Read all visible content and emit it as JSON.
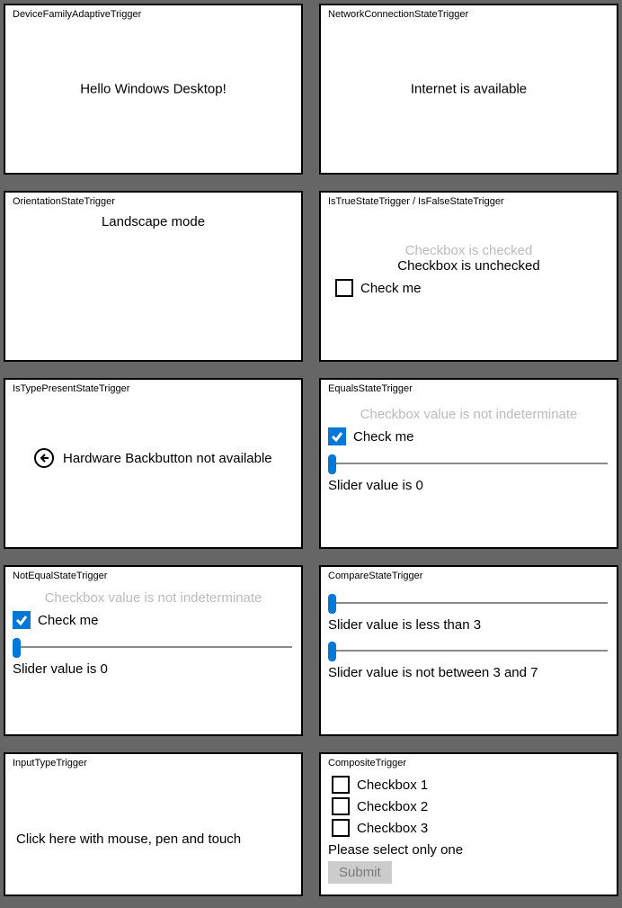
{
  "cards": {
    "deviceFamily": {
      "title": "DeviceFamilyAdaptiveTrigger",
      "message": "Hello Windows Desktop!"
    },
    "network": {
      "title": "NetworkConnectionStateTrigger",
      "message": "Internet is available"
    },
    "orientation": {
      "title": "OrientationStateTrigger",
      "message": "Landscape mode"
    },
    "trueFalse": {
      "title": "IsTrueStateTrigger / IsFalseStateTrigger",
      "checkedMsg": "Checkbox is checked",
      "uncheckedMsg": "Checkbox is unchecked",
      "checkLabel": "Check me"
    },
    "typePresent": {
      "title": "IsTypePresentStateTrigger",
      "message": "Hardware Backbutton not available"
    },
    "equals": {
      "title": "EqualsStateTrigger",
      "greyMsg": "Checkbox value is not indeterminate",
      "checkLabel": "Check me",
      "sliderMsg": "Slider value is 0"
    },
    "notEqual": {
      "title": "NotEqualStateTrigger",
      "greyMsg": "Checkbox value is not indeterminate",
      "checkLabel": "Check me",
      "sliderMsg": "Slider value is 0"
    },
    "compare": {
      "title": "CompareStateTrigger",
      "msg1": "Slider value is less than 3",
      "msg2": "Slider value is not between 3 and 7"
    },
    "inputType": {
      "title": "InputTypeTrigger",
      "message": "Click here with mouse, pen and touch"
    },
    "composite": {
      "title": "CompositeTrigger",
      "cb1": "Checkbox 1",
      "cb2": "Checkbox 2",
      "cb3": "Checkbox 3",
      "selectMsg": "Please select only one",
      "submit": "Submit"
    }
  }
}
